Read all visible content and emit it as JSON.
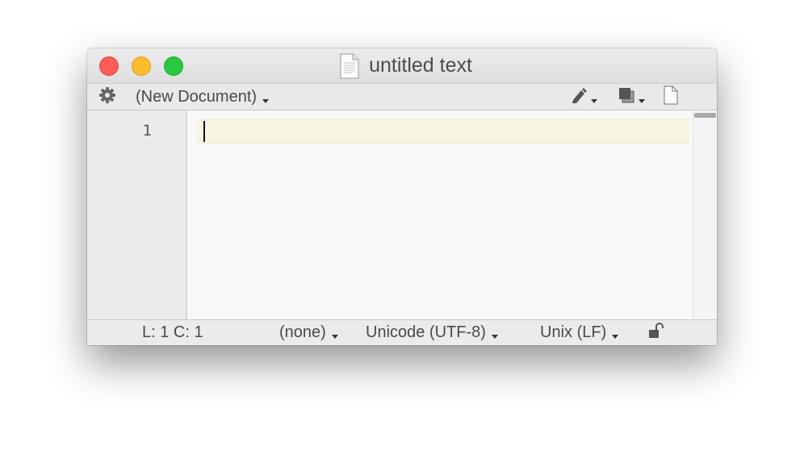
{
  "window": {
    "title": "untitled text"
  },
  "toolbar": {
    "syntax_menu_label": "(New Document)",
    "icons": [
      "gear-icon",
      "pen-icon",
      "layers-icon",
      "document-icon"
    ]
  },
  "editor": {
    "line_numbers": [
      "1"
    ],
    "content": ""
  },
  "statusbar": {
    "position": "L: 1 C: 1",
    "language": "(none)",
    "encoding": "Unicode (UTF-8)",
    "line_endings": "Unix (LF)",
    "lock_state": "unlocked"
  },
  "colors": {
    "close": "#fc5d57",
    "minimize": "#fdbc2e",
    "zoom": "#29c840",
    "current_line": "#f8f6e3"
  }
}
